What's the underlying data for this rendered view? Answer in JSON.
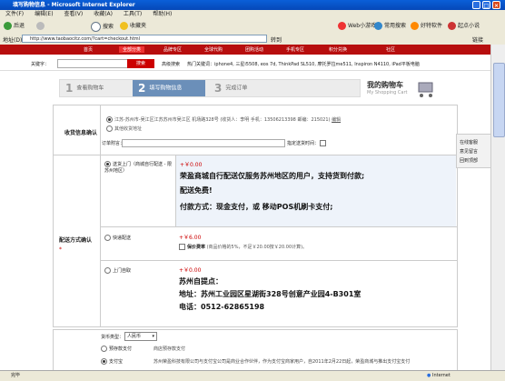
{
  "window": {
    "title": "填写购物信息 - Microsoft Internet Explorer"
  },
  "menu": [
    "文件(F)",
    "编辑(E)",
    "查看(V)",
    "收藏(A)",
    "工具(T)",
    "帮助(H)"
  ],
  "toolbar": {
    "back": "后退",
    "search": "搜索",
    "favorites": "收藏夹",
    "weibo": "Web小游戏",
    "common": "常用搜索",
    "good_software": "好特软件",
    "jump": "起点小说"
  },
  "address": {
    "label": "地址(D)",
    "url": "http://www.taobaocitz.com/?cart=checkout.html",
    "go": "转到",
    "links": "链接"
  },
  "site": {
    "nav": [
      "首页",
      "全部分类",
      "品牌专区",
      "全球代购",
      "团购活动",
      "手机专区",
      "积分兑换",
      "社区"
    ],
    "search_label": "关键字：",
    "search_button": "搜索",
    "advanced": "高级搜索",
    "hot_label": "热门关键词：",
    "hot_words": "iphone4, 三星i5508, eos 7d, ThinkPad SL510, 摩托罗拉me511, Inspiron N4110, iPad平板电脑"
  },
  "steps": [
    {
      "num": "1",
      "label": "查看购物车"
    },
    {
      "num": "2",
      "label": "填写购物信息"
    },
    {
      "num": "3",
      "label": "完成订单"
    }
  ],
  "cart_title": "我的购物车",
  "cart_sub": "My Shopping Cart",
  "receiver": {
    "section": "收货信息确认",
    "address": "江苏-苏州市-吴江区江苏苏州市吴江区 机场路328号 (收货人：李明 手机：13506213398 邮编：215021)",
    "edit": "编辑",
    "other": "其他收货地址",
    "order_note_label": "订单附言：",
    "delivery_time": "指定送货时间："
  },
  "shipping": {
    "section": "配送方式确认",
    "options": [
      {
        "name": "送货上门（商城自行配送 - 限苏州地区）",
        "price": "+￥0.00",
        "lines": [
          "荣盈商城自行配送仅服务苏州地区的用户，支持货到付款;",
          "配送免费!",
          "付款方式：现金支付，或 移动POS机刷卡支付;"
        ]
      },
      {
        "name": "快递配送",
        "price": "+￥6.00",
        "insurance": "保价费率",
        "insurance_note": "(商品价格的5%，不足￥20.00按￥20.00计算)。"
      },
      {
        "name": "上门自取",
        "price": "+￥0.00",
        "lines": [
          "苏州自提点：",
          "地址：苏州工业园区星湖街328号创意产业园4-B301室",
          "电话：0512-62865198"
        ]
      }
    ]
  },
  "payment": {
    "currency_label": "货币类型：",
    "currency": "人民币",
    "options": [
      "预存款支付",
      "支付宝"
    ],
    "prepay_note": "商店预存款支付",
    "alipay_note": "苏州荣盈科技有限公司与支付宝公司是商业合作伙伴，作为支付宝商家用户，自2011年2月22日起，荣盈商城与推出支付宝支付"
  },
  "sidebox": {
    "items": [
      "在线客服",
      "意见留言",
      "回到顶部"
    ]
  },
  "status": {
    "left": "完毕",
    "zone": "Internet"
  }
}
